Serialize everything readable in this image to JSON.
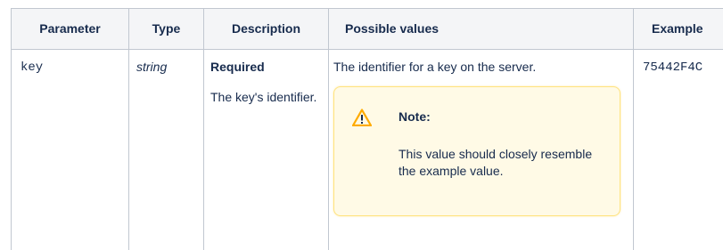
{
  "table": {
    "headers": {
      "parameter": "Parameter",
      "type": "Type",
      "description": "Description",
      "possible_values": "Possible values",
      "example": "Example"
    },
    "row": {
      "parameter": "key",
      "type": "string",
      "description_required": "Required",
      "description_text": "The key's identifier.",
      "possible_values_text": "The identifier for a key on the server.",
      "example": "75442F4C"
    }
  },
  "note": {
    "icon": "warning-icon",
    "title": "Note:",
    "body": "This value should closely resemble the example value."
  },
  "colors": {
    "header_bg": "#f4f5f7",
    "border": "#c1c7d0",
    "note_bg": "#fffae6",
    "note_border": "#ffe380",
    "warning_icon": "#ffab00"
  }
}
